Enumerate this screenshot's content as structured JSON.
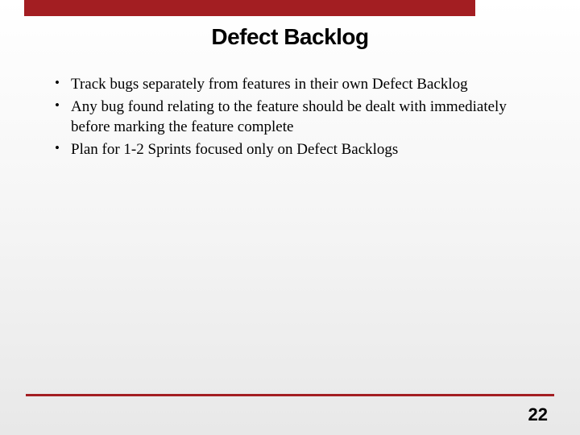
{
  "slide": {
    "title": "Defect Backlog",
    "bullets": [
      "Track bugs separately from features in their own Defect Backlog",
      "Any bug found relating to the feature should be dealt with immediately before marking the feature complete",
      "Plan for 1-2 Sprints focused only on Defect Backlogs"
    ],
    "page_number": "22",
    "accent_color": "#a31e22"
  }
}
